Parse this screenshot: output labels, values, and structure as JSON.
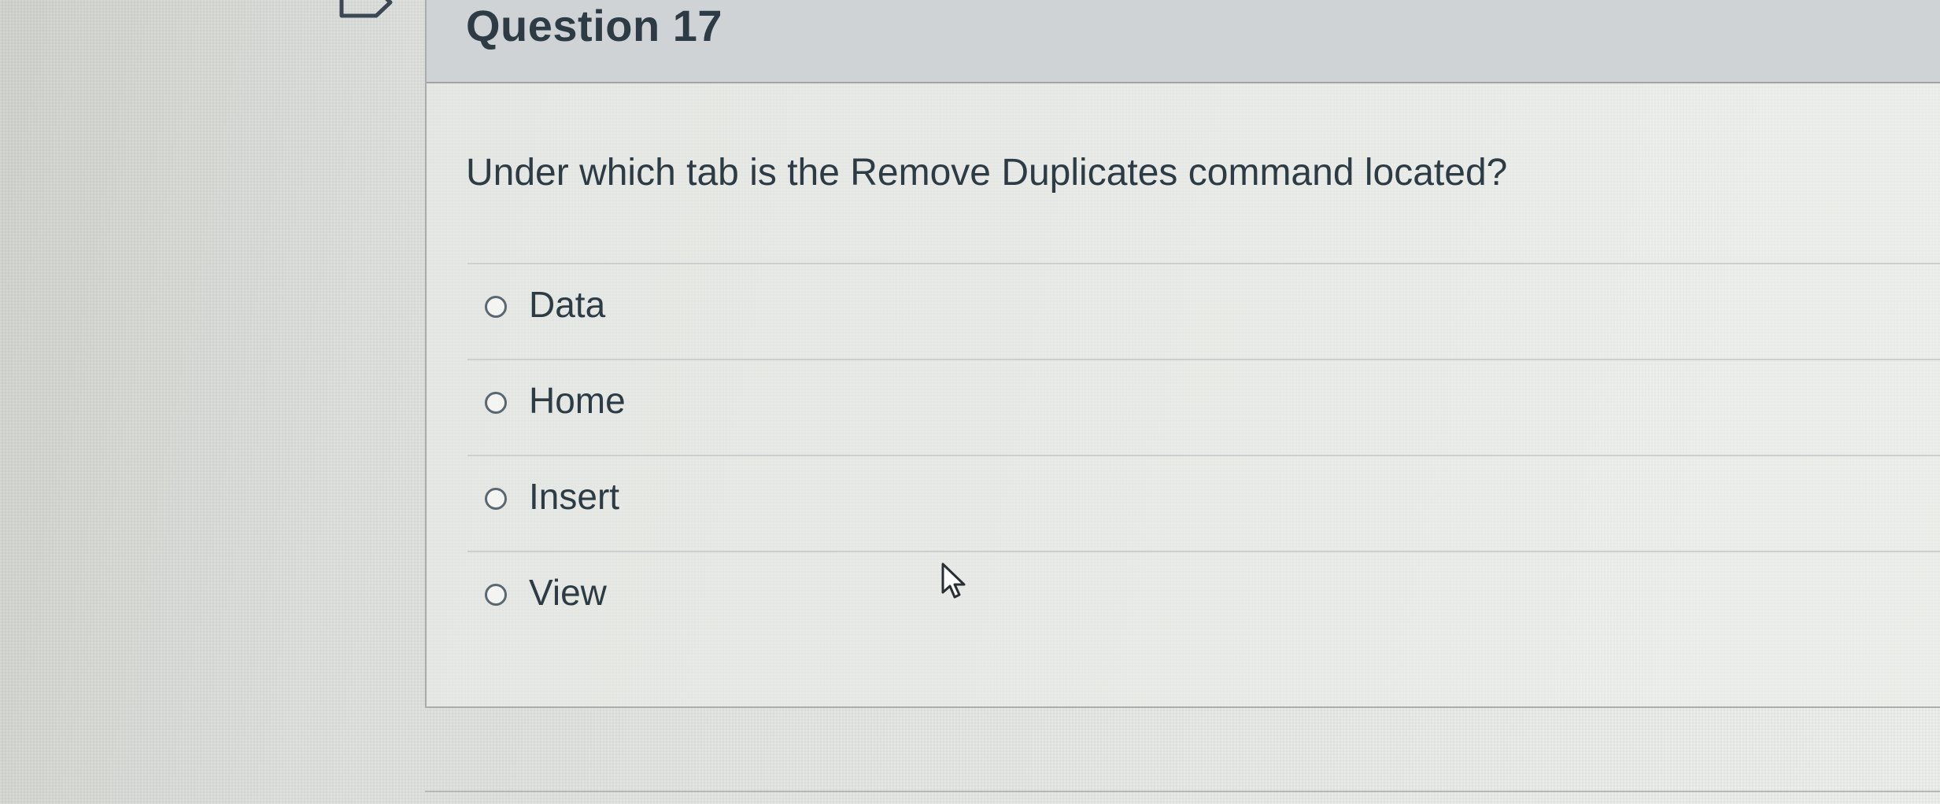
{
  "question": {
    "title": "Question 17",
    "text": "Under which tab is the Remove Duplicates command located?",
    "answers": [
      {
        "label": "Data"
      },
      {
        "label": "Home"
      },
      {
        "label": "Insert"
      },
      {
        "label": "View"
      }
    ]
  },
  "icons": {
    "flag": "flag-outline-icon",
    "cursor": "mouse-pointer-icon"
  }
}
